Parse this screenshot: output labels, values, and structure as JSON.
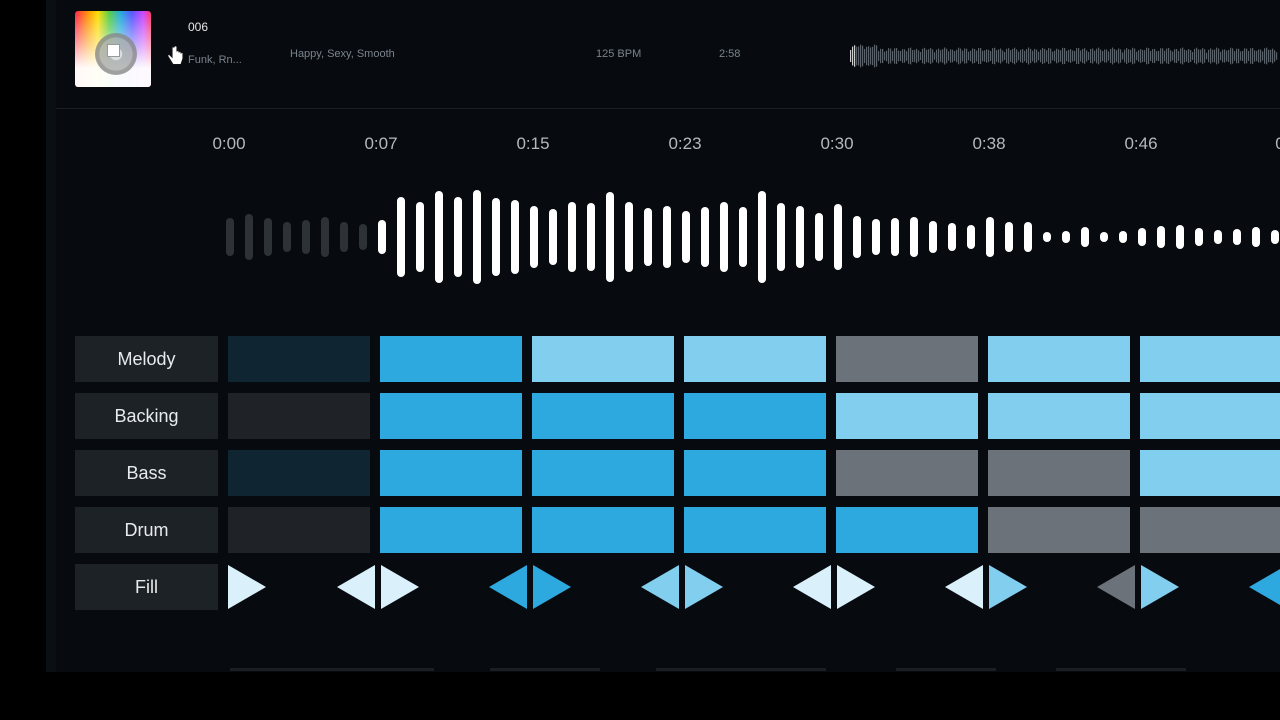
{
  "track": {
    "number": "006",
    "genre": "Funk, Rn...",
    "moods": "Happy, Sexy, Smooth",
    "bpm": "125 BPM",
    "duration": "2:58"
  },
  "timeline": {
    "ticks": [
      "0:00",
      "0:07",
      "0:15",
      "0:23",
      "0:30",
      "0:38",
      "0:46",
      "0"
    ]
  },
  "colors": {
    "dark_teal": "#0f2531",
    "dark_gray": "#1f2327",
    "blue": "#2ea9df",
    "light_blue": "#82ceef",
    "gray": "#6b7279",
    "fill_white": "#daf1fb",
    "background": "#070b0f"
  },
  "grid": {
    "rows": [
      {
        "label": "Melody",
        "cells": [
          "dark_teal",
          "blue",
          "light_blue",
          "light_blue",
          "gray",
          "light_blue",
          "light_blue"
        ]
      },
      {
        "label": "Backing",
        "cells": [
          "dark_gray",
          "blue",
          "blue",
          "blue",
          "light_blue",
          "light_blue",
          "light_blue"
        ]
      },
      {
        "label": "Bass",
        "cells": [
          "dark_teal",
          "blue",
          "blue",
          "blue",
          "gray",
          "gray",
          "light_blue"
        ]
      },
      {
        "label": "Drum",
        "cells": [
          "dark_gray",
          "blue",
          "blue",
          "blue",
          "blue",
          "gray",
          "gray"
        ]
      }
    ],
    "fill_label": "Fill",
    "fill_markers": [
      {
        "left": null,
        "right": "fill_white"
      },
      {
        "left": "fill_white",
        "right": "fill_white"
      },
      {
        "left": "blue",
        "right": "blue"
      },
      {
        "left": "light_blue",
        "right": "light_blue"
      },
      {
        "left": "fill_white",
        "right": "fill_white"
      },
      {
        "left": "fill_white",
        "right": "light_blue"
      },
      {
        "left": "gray",
        "right": "light_blue"
      },
      {
        "left": "blue",
        "right": null
      }
    ]
  },
  "icons": {
    "album_art": "album-art-icon",
    "cursor": "hand-cursor-icon",
    "play_fill": "triangle-marker-icon"
  }
}
